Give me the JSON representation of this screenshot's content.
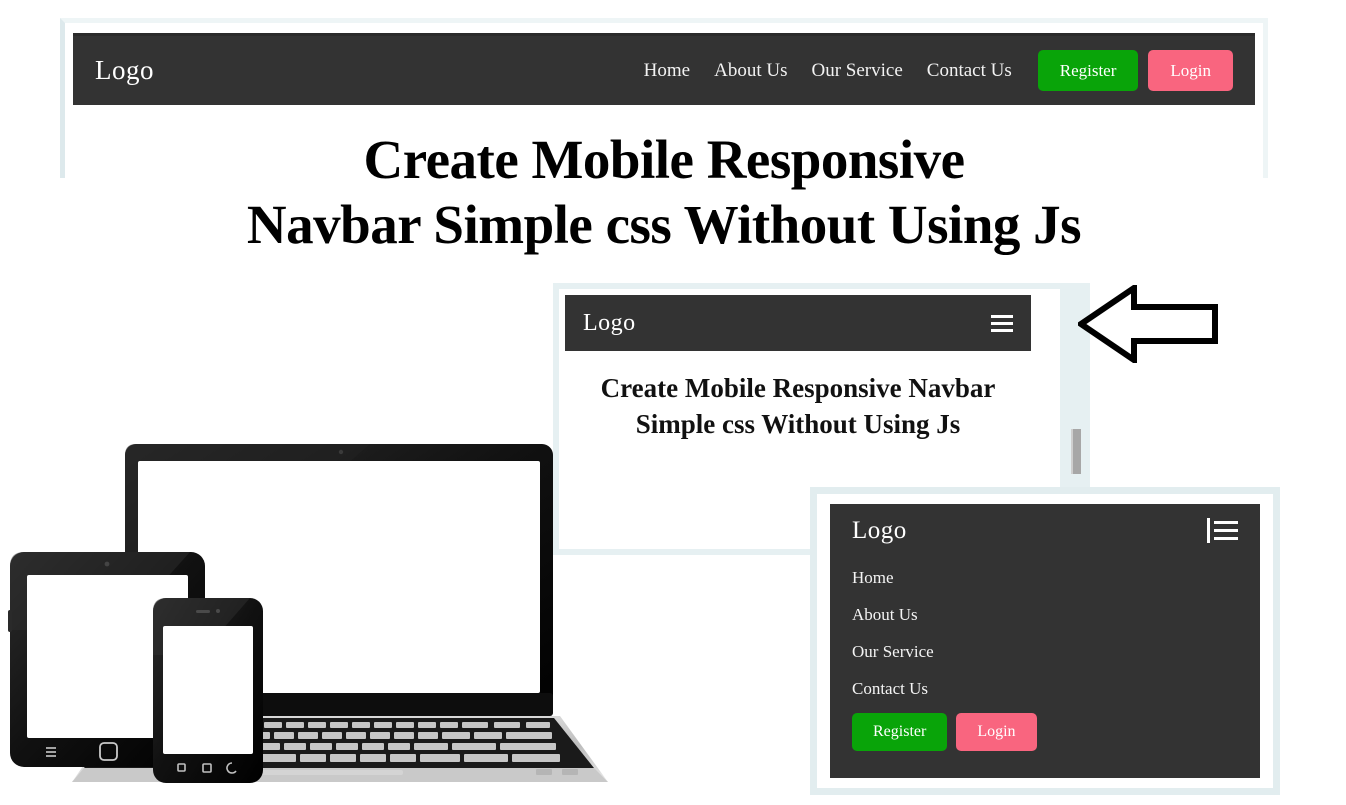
{
  "brand": {
    "logo": "Logo"
  },
  "hero": {
    "heading_line1": "Create Mobile Responsive",
    "heading_line2": "Navbar Simple css Without Using Js"
  },
  "desktop": {
    "logo": "Logo",
    "nav_links": [
      {
        "label": "Home"
      },
      {
        "label": "About Us"
      },
      {
        "label": "Our Service"
      },
      {
        "label": "Contact Us"
      }
    ],
    "register_label": "Register",
    "login_label": "Login"
  },
  "tablet": {
    "logo": "Logo",
    "menu_icon": "hamburger-icon",
    "heading": "Create Mobile Responsive Navbar Simple css Without Using Js"
  },
  "mobile": {
    "logo": "Logo",
    "menu_icon": "hamburger-icon",
    "menu_items": [
      {
        "label": "Home"
      },
      {
        "label": "About Us"
      },
      {
        "label": "Our Service"
      },
      {
        "label": "Contact Us"
      }
    ],
    "register_label": "Register",
    "login_label": "Login"
  },
  "annotation": {
    "arrow_icon": "arrow-left-icon"
  },
  "devices_illustration": "laptop-tablet-phone-devices-image",
  "colors": {
    "navbar_dark": "#333333",
    "register_green": "#09a409",
    "login_pink": "#f9657f",
    "frame_blue": "#e2edef",
    "text_light": "#f4f4f4",
    "heading_black": "#000000"
  }
}
